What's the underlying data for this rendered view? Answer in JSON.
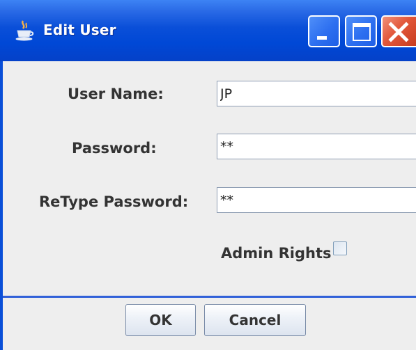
{
  "window": {
    "title": "Edit User",
    "controls": {
      "minimize": "minimize-icon",
      "maximize": "maximize-icon",
      "close": "close-icon"
    }
  },
  "form": {
    "username_label": "User Name:",
    "username_value": "JP",
    "password_label": "Password:",
    "password_value": "**",
    "retype_label": "ReType Password:",
    "retype_value": "**",
    "admin_label": "Admin Rights",
    "admin_checked": false
  },
  "buttons": {
    "ok": "OK",
    "cancel": "Cancel"
  },
  "colors": {
    "titlebar": "#0a4fd8",
    "close_button": "#e2573a",
    "panel": "#eeeeee"
  }
}
